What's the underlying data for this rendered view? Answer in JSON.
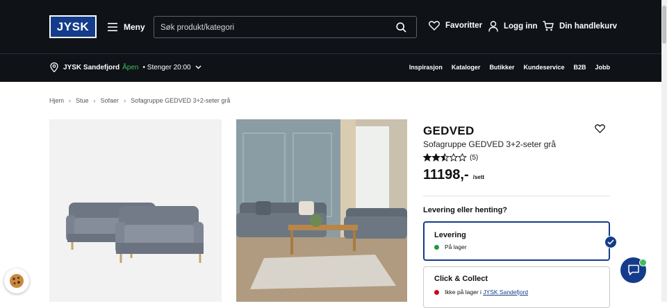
{
  "header": {
    "logo_text": "JYSK",
    "menu_label": "Meny",
    "search_placeholder": "Søk produkt/kategori",
    "favorites_label": "Favoritter",
    "login_label": "Logg inn",
    "cart_label": "Din handlekurv"
  },
  "store_bar": {
    "store_name": "JYSK Sandefjord",
    "open_status": "Åpen",
    "closes_text": "• Stenger 20:00",
    "nav": [
      "Inspirasjon",
      "Kataloger",
      "Butikker",
      "Kundeservice",
      "B2B",
      "Jobb"
    ]
  },
  "breadcrumb": [
    "Hjem",
    "Stue",
    "Sofaer",
    "Sofagruppe GEDVED 3+2-seter grå"
  ],
  "product": {
    "name": "GEDVED",
    "subtitle": "Sofagruppe GEDVED 3+2-seter grå",
    "rating": 2.5,
    "rating_max": 5,
    "review_count": "(5)",
    "price": "11198,-",
    "price_unit": "/sett"
  },
  "delivery": {
    "question": "Levering eller henting?",
    "options": [
      {
        "title": "Levering",
        "status": "På lager",
        "status_color": "#1e9b3c",
        "selected": true
      },
      {
        "title": "Click & Collect",
        "status_prefix": "Ikke på lager i",
        "status_link": "JYSK Sandefjord",
        "status_color": "#d0021b",
        "selected": false
      }
    ]
  },
  "colors": {
    "header_bg": "#0f1217",
    "brand_blue": "#143c8a",
    "open_green": "#3fbe5a"
  }
}
